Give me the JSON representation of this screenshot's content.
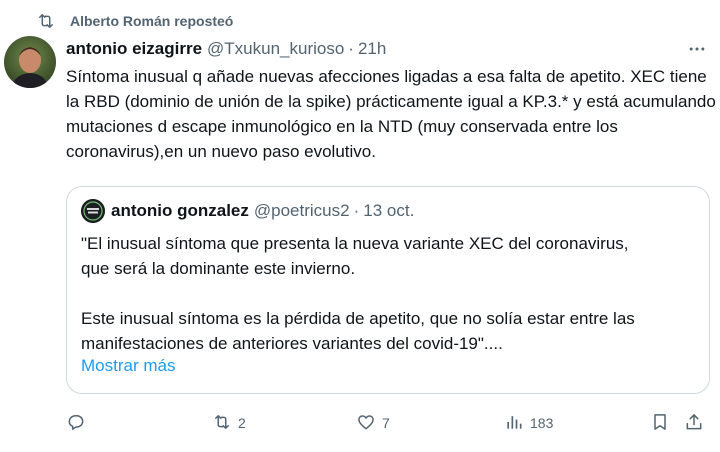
{
  "repost": {
    "text": "Alberto Román reposteó",
    "icon": "repost-icon"
  },
  "tweet": {
    "author_name": "antonio eizagirre",
    "author_handle": "@Txukun_kurioso",
    "separator": "·",
    "time": "21h",
    "text": "Síntoma inusual q añade nuevas afecciones ligadas a esa falta de apetito. XEC tiene la RBD (dominio de unión de la spike) prácticamente igual a KP.3.* y está acumulando mutaciones d escape inmunológico en la NTD (muy conservada entre los coronavirus),en un nuevo paso evolutivo."
  },
  "quote": {
    "author_name": "antonio gonzalez",
    "author_handle": "@poetricus2",
    "separator": "·",
    "time": "13 oct.",
    "text": "\"El inusual síntoma que presenta la nueva variante XEC del coronavirus,\nque será la dominante este invierno.\n\nEste inusual síntoma es la pérdida de apetito, que no solía estar entre las\nmanifestaciones de anteriores variantes del covid-19\"....",
    "show_more": "Mostrar más"
  },
  "actions": {
    "reply": {
      "icon": "reply-icon",
      "count": ""
    },
    "repost": {
      "icon": "repost-icon",
      "count": "2"
    },
    "like": {
      "icon": "heart-icon",
      "count": "7"
    },
    "views": {
      "icon": "views-icon",
      "count": "183"
    },
    "bookmark": {
      "icon": "bookmark-icon"
    },
    "share": {
      "icon": "share-icon"
    }
  },
  "colors": {
    "text": "#0f1419",
    "secondary": "#536471",
    "link": "#1d9bf0",
    "border": "#cfd9de"
  }
}
